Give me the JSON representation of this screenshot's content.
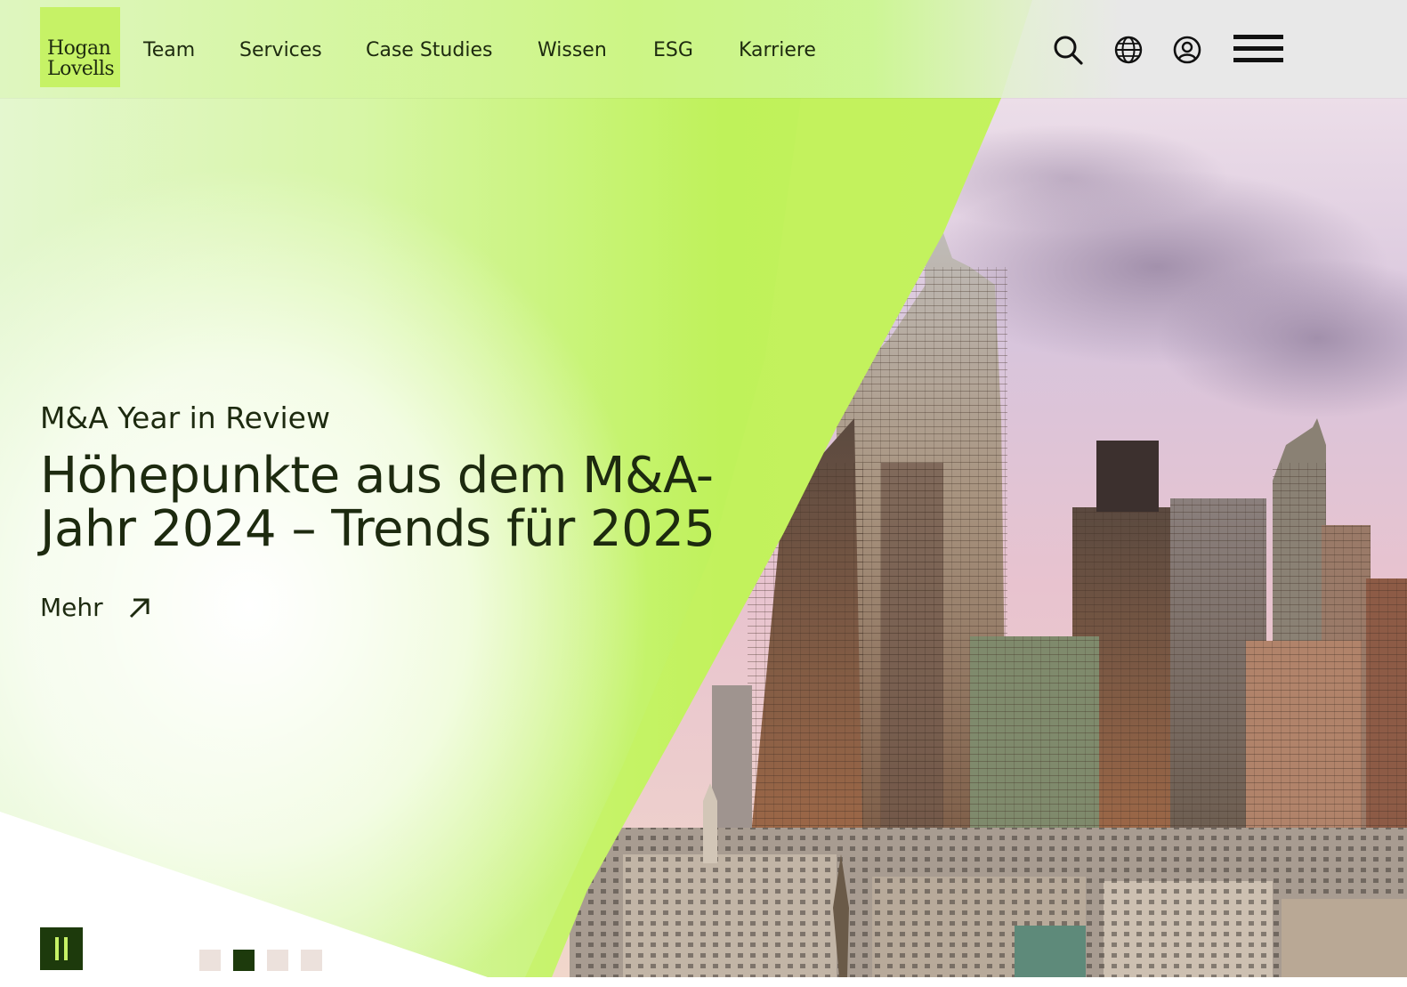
{
  "brand": {
    "logo_line1": "Hogan",
    "logo_line2": "Lovells",
    "accent_color": "#c6f266",
    "dark_color": "#1d3a0c"
  },
  "nav": {
    "items": [
      {
        "label": "Team"
      },
      {
        "label": "Services"
      },
      {
        "label": "Case Studies"
      },
      {
        "label": "Wissen"
      },
      {
        "label": "ESG"
      },
      {
        "label": "Karriere"
      }
    ]
  },
  "header_icons": [
    "search-icon",
    "globe-icon",
    "user-icon",
    "menu-icon"
  ],
  "hero": {
    "eyebrow": "M&A Year in Review",
    "headline": "Höhepunkte aus dem M&A-Jahr 2024 – Trends für 2025",
    "cta_label": "Mehr",
    "cta_icon": "arrow-up-right-icon"
  },
  "carousel": {
    "pause_icon": "pause-icon",
    "slide_count": 4,
    "active_slide": 2
  }
}
